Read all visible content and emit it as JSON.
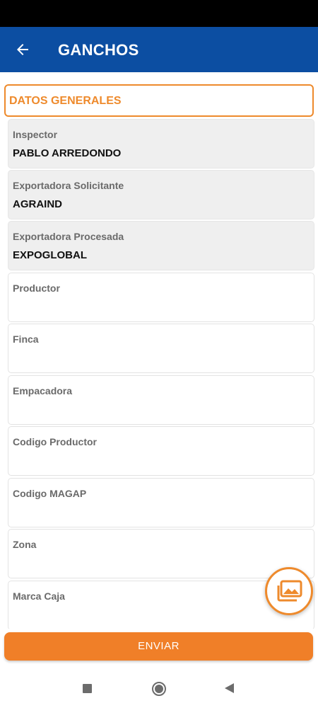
{
  "header": {
    "title": "GANCHOS"
  },
  "section": {
    "title": "DATOS GENERALES"
  },
  "fields": [
    {
      "label": "Inspector",
      "value": "PABLO ARREDONDO"
    },
    {
      "label": "Exportadora Solicitante",
      "value": "AGRAIND"
    },
    {
      "label": "Exportadora Procesada",
      "value": "EXPOGLOBAL"
    },
    {
      "label": "Productor",
      "value": ""
    },
    {
      "label": "Finca",
      "value": ""
    },
    {
      "label": "Empacadora",
      "value": ""
    },
    {
      "label": "Codigo Productor",
      "value": ""
    },
    {
      "label": "Codigo MAGAP",
      "value": ""
    },
    {
      "label": "Zona",
      "value": ""
    },
    {
      "label": "Marca Caja",
      "value": ""
    }
  ],
  "actions": {
    "submit_label": "ENVIAR"
  },
  "icons": {
    "back": "arrow-left-icon",
    "fab": "image-gallery-icon"
  },
  "colors": {
    "app_bar": "#0c4ea2",
    "accent": "#ee8a2c",
    "button": "#f07f28"
  }
}
